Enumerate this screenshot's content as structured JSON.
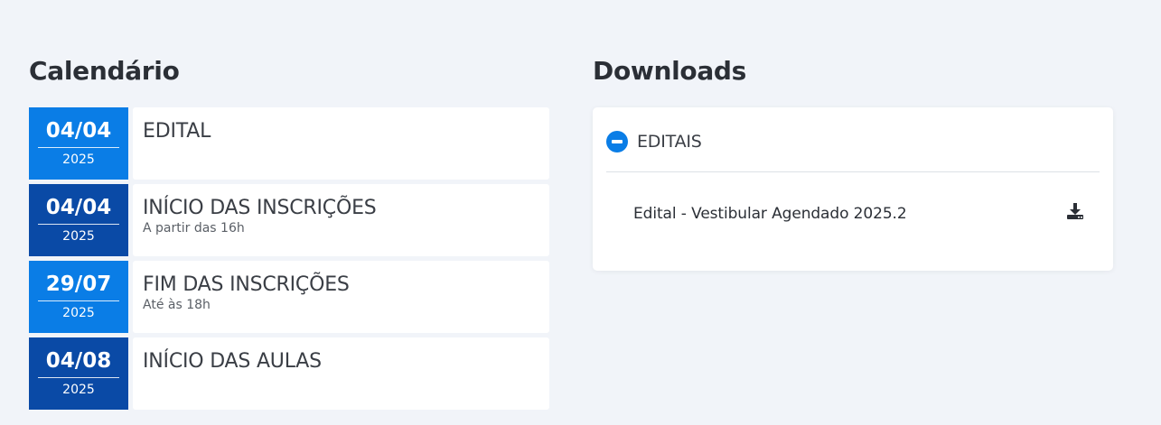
{
  "calendar": {
    "title": "Calendário",
    "items": [
      {
        "date": "04/04",
        "year": "2025",
        "name": "EDITAL",
        "sub": "",
        "variant": "light"
      },
      {
        "date": "04/04",
        "year": "2025",
        "name": "INÍCIO DAS INSCRIÇÕES",
        "sub": "A partir das 16h",
        "variant": "dark"
      },
      {
        "date": "29/07",
        "year": "2025",
        "name": "FIM DAS INSCRIÇÕES",
        "sub": "Até às 18h",
        "variant": "light"
      },
      {
        "date": "04/08",
        "year": "2025",
        "name": "INÍCIO DAS AULAS",
        "sub": "",
        "variant": "dark"
      }
    ]
  },
  "downloads": {
    "title": "Downloads",
    "section_label": "EDITAIS",
    "section_icon": "minus-circle-icon",
    "files": [
      {
        "label": "Edital - Vestibular Agendado 2025.2",
        "icon": "download-icon"
      }
    ]
  },
  "colors": {
    "background": "#f1f4f9",
    "accent_light": "#0a7de6",
    "accent_dark": "#0a4aa6",
    "text": "#2b2f36"
  }
}
